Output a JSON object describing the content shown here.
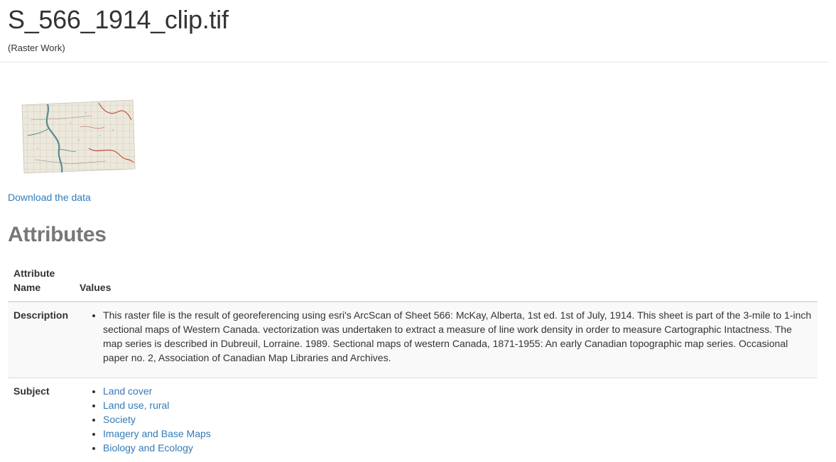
{
  "header": {
    "title": "S_566_1914_clip.tif",
    "subtitle": "(Raster Work)"
  },
  "thumbnail": {
    "paper_color": "#ece8dc",
    "river_color": "#5a8a8f",
    "red_line_color": "#c0503a"
  },
  "download": {
    "label": "Download the data"
  },
  "attributes": {
    "heading": "Attributes",
    "columns": {
      "name": "Attribute Name",
      "values": "Values"
    },
    "description": {
      "label": "Description",
      "text": "This raster file is the result of georeferencing using esri's ArcScan of Sheet 566: McKay, Alberta, 1st ed. 1st of July, 1914. This sheet is part of the 3-mile to 1-inch sectional maps of Western Canada. vectorization was undertaken to extract a measure of line work density in order to measure Cartographic Intactness. The map series is described in Dubreuil, Lorraine. 1989. Sectional maps of western Canada, 1871-1955: An early Canadian topographic map series. Occasional paper no. 2, Association of Canadian Map Libraries and Archives."
    },
    "subject": {
      "label": "Subject",
      "items": [
        "Land cover",
        "Land use, rural",
        "Society",
        "Imagery and Base Maps",
        "Biology and Ecology"
      ]
    }
  },
  "colors": {
    "link": "#337ab7",
    "heading_gray": "#777777",
    "text": "#333333"
  }
}
